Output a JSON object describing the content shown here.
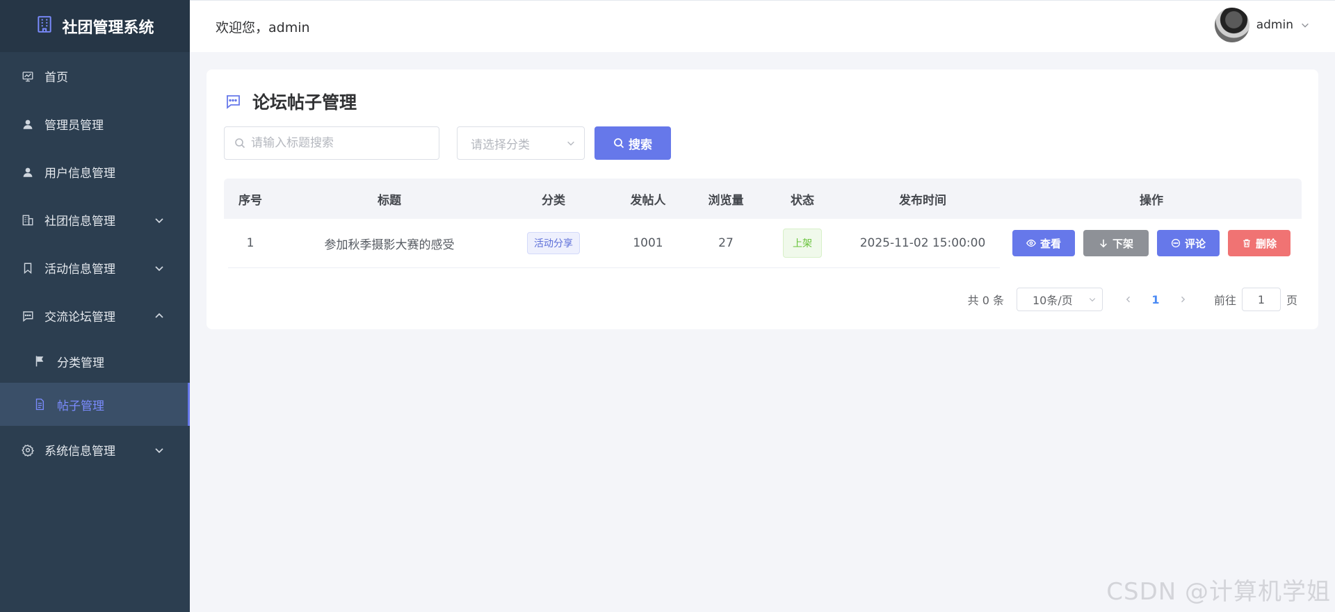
{
  "sidebar": {
    "brand": "社团管理系统",
    "items": [
      {
        "label": "首页",
        "icon": "chart-board-icon"
      },
      {
        "label": "管理员管理",
        "icon": "user-icon"
      },
      {
        "label": "用户信息管理",
        "icon": "user-icon"
      },
      {
        "label": "社团信息管理",
        "icon": "building-icon",
        "expandable": true
      },
      {
        "label": "活动信息管理",
        "icon": "bookmark-icon",
        "expandable": true
      },
      {
        "label": "交流论坛管理",
        "icon": "chat-icon",
        "expanded": true
      }
    ],
    "sub_items": [
      {
        "label": "分类管理",
        "icon": "flag-icon"
      },
      {
        "label": "帖子管理",
        "icon": "document-icon",
        "active": true
      }
    ],
    "last_item": {
      "label": "系统信息管理",
      "icon": "gear-icon",
      "expandable": true
    }
  },
  "header": {
    "welcome": "欢迎您，admin",
    "user_name": "admin"
  },
  "page": {
    "title": "论坛帖子管理",
    "search_placeholder": "请输入标题搜索",
    "category_placeholder": "请选择分类",
    "search_button": "搜索"
  },
  "table": {
    "columns": [
      "序号",
      "标题",
      "分类",
      "发帖人",
      "浏览量",
      "状态",
      "发布时间",
      "操作"
    ],
    "rows": [
      {
        "index": "1",
        "title": "参加秋季摄影大赛的感受",
        "category": "活动分享",
        "author": "1001",
        "views": "27",
        "status": "上架",
        "time": "2025-11-02 15:00:00",
        "actions": {
          "view": "查看",
          "down": "下架",
          "comment": "评论",
          "delete": "删除"
        }
      }
    ]
  },
  "pagination": {
    "total": "共 0 条",
    "page_size": "10条/页",
    "current_page": "1",
    "goto_prefix": "前往",
    "goto_value": "1",
    "goto_suffix": "页"
  },
  "watermark": "CSDN @计算机学姐",
  "colors": {
    "sidebar": "#2c3e50",
    "accent": "#6678ea",
    "danger": "#f07373",
    "muted": "#8e9197",
    "success": "#67c23a"
  }
}
